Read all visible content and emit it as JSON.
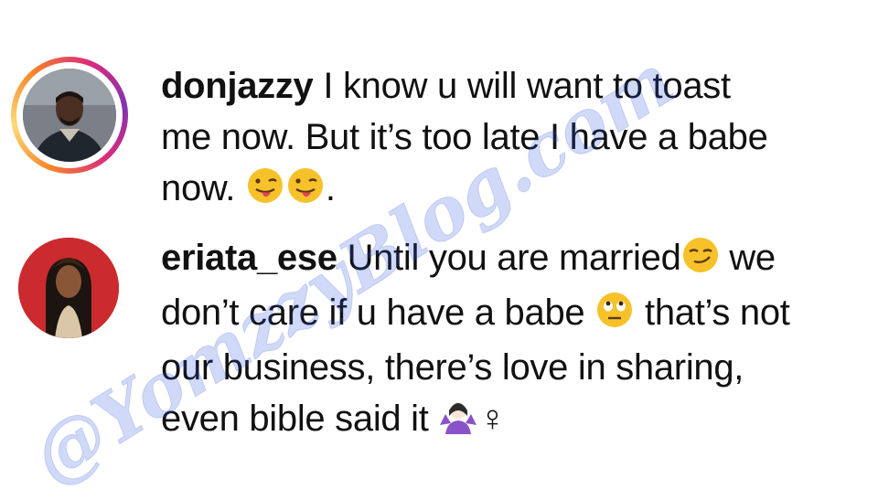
{
  "comments": [
    {
      "username": "donjazzy",
      "lines": [
        "I know u will want to toast",
        "me now. But it’s too late I have a babe",
        "now."
      ],
      "trailing_punct": ".",
      "emojis": [
        "winking-face-with-tongue",
        "winking-face-with-tongue"
      ],
      "avatar_ring": true
    },
    {
      "username": "eriata_ese",
      "lines": [
        "Until you are married",
        "we",
        "don’t care if u have a babe",
        "that’s not",
        "our business, there’s love in sharing,",
        "even bible said it"
      ],
      "female_sign": "♀",
      "emojis": [
        "smirking-face",
        "face-with-rolling-eyes",
        "woman-shrugging"
      ],
      "avatar_ring": false
    }
  ],
  "watermark": "@YomzzyBlog.com",
  "colors": {
    "text": "#111111",
    "watermark": "#2850dc",
    "emoji": "#f7c12a",
    "story_ring": [
      "#f58529",
      "#dd2a7b",
      "#8134af"
    ]
  }
}
